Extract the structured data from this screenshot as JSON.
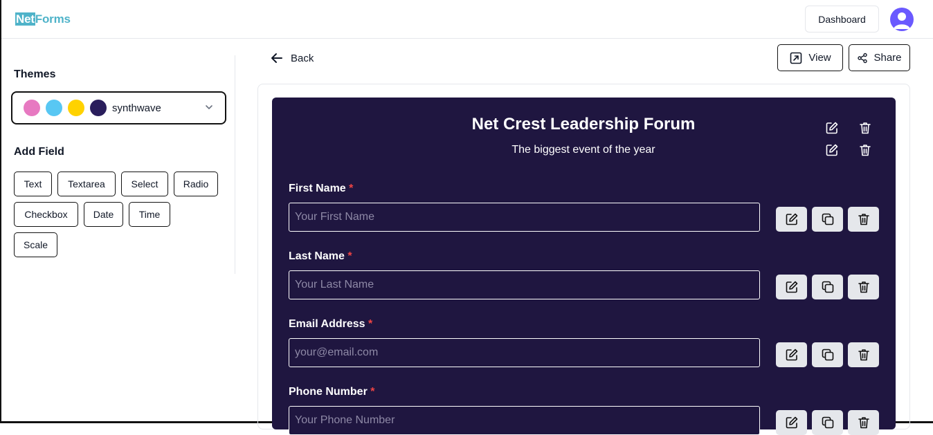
{
  "header": {
    "logo_part1": "Net",
    "logo_part2": "Forms",
    "dashboard_label": "Dashboard"
  },
  "sidebar": {
    "themes_title": "Themes",
    "theme": {
      "name": "synthwave",
      "colors": [
        "#e779c1",
        "#58c7f3",
        "#ffd200",
        "#2a1e5c"
      ]
    },
    "add_field_title": "Add Field",
    "field_types": [
      "Text",
      "Textarea",
      "Select",
      "Radio",
      "Checkbox",
      "Date",
      "Time",
      "Scale"
    ]
  },
  "toolbar": {
    "back_label": "Back",
    "view_label": "View",
    "share_label": "Share"
  },
  "form": {
    "title": "Net Crest Leadership Forum",
    "subtitle": "The biggest event of the year",
    "background": "#1f1640",
    "fields": [
      {
        "label": "First Name",
        "required": "*",
        "placeholder": "Your First Name"
      },
      {
        "label": "Last Name",
        "required": "*",
        "placeholder": "Your Last Name"
      },
      {
        "label": "Email Address",
        "required": "*",
        "placeholder": "your@email.com"
      },
      {
        "label": "Phone Number",
        "required": "*",
        "placeholder": "Your Phone Number"
      }
    ]
  },
  "colors": {
    "accent": "#4fb3c9",
    "required": "#ef4444",
    "avatar": "#6a59ff"
  }
}
